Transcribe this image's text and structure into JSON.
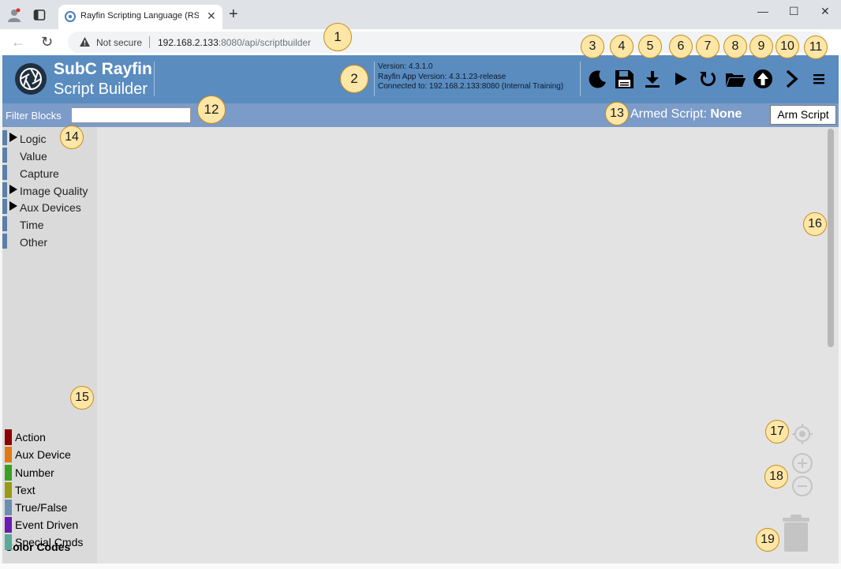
{
  "browser": {
    "tab_title": "Rayfin Scripting Language (RSL) -",
    "tab_close": "✕",
    "new_tab": "+",
    "not_secure": "Not secure",
    "url_host": "192.168.2.133",
    "url_rest": ":8080/api/scriptbuilder",
    "window_controls": {
      "minimize": "—",
      "maximize": "☐",
      "close": "✕"
    },
    "back": "←",
    "reload": "↻"
  },
  "header": {
    "brand_line1": "SubC Rayfin",
    "brand_line2": "Script Builder",
    "version": "Version: 4.3.1.0",
    "app_version": "Rayfin App Version: 4.3.1.23-release",
    "connected": "Connected to: 192.168.2.133:8080 (Internal Training)",
    "icons": [
      "moon-icon",
      "save-icon",
      "download-icon",
      "play-icon",
      "refresh-icon",
      "folder-icon",
      "upload-icon",
      "chevron-right-icon",
      "menu-icon"
    ]
  },
  "filterbar": {
    "label": "Filter Blocks",
    "input_value": "",
    "armed_label": "Armed Script:",
    "armed_value": "None",
    "arm_button": "Arm Script"
  },
  "sidebar": {
    "categories": [
      {
        "label": "Logic",
        "expandable": true
      },
      {
        "label": "Value",
        "expandable": false
      },
      {
        "label": "Capture",
        "expandable": false
      },
      {
        "label": "Image Quality",
        "expandable": true
      },
      {
        "label": "Aux Devices",
        "expandable": true
      },
      {
        "label": "Time",
        "expandable": false
      },
      {
        "label": "Other",
        "expandable": false
      }
    ],
    "category_color": "#5a7fa8",
    "color_codes_title": "Color Codes",
    "color_codes": [
      {
        "label": "Action",
        "color": "#8b0000"
      },
      {
        "label": "Aux Device",
        "color": "#e07a10"
      },
      {
        "label": "Number",
        "color": "#3aa020"
      },
      {
        "label": "Text",
        "color": "#9a9a14"
      },
      {
        "label": "True/False",
        "color": "#6a8eb2"
      },
      {
        "label": "Event Driven",
        "color": "#6a1ab0"
      },
      {
        "label": "Special Cmds",
        "color": "#5aaa96"
      }
    ]
  },
  "workspace": {
    "controls": [
      "target-icon",
      "zoom-in-icon",
      "zoom-out-icon",
      "trash-icon"
    ]
  },
  "callouts": [
    "1",
    "2",
    "3",
    "4",
    "5",
    "6",
    "7",
    "8",
    "9",
    "10",
    "11",
    "12",
    "13",
    "14",
    "15",
    "16",
    "17",
    "18",
    "19"
  ],
  "colors": {
    "header_bg": "#5a8cc0",
    "filterbar_bg": "#7b9bc8",
    "sidebar_bg": "#dadada",
    "workspace_bg": "#e3e3e3",
    "callout_fill": "#fde6a6",
    "callout_border": "#c98d17"
  }
}
